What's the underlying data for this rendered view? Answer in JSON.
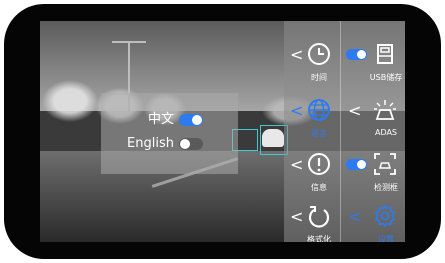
{
  "language_popup": {
    "options": [
      {
        "label": "中文",
        "state": "on"
      },
      {
        "label": "English",
        "state": "off"
      }
    ]
  },
  "menu": {
    "time_label": "时间",
    "usb_label": "USB储存",
    "language_label": "语言",
    "adas_label": "ADAS",
    "info_label": "信息",
    "detect_label": "检测框",
    "format_label": "格式化",
    "settings_label": "设置"
  },
  "colors": {
    "accent": "#2d7bf0",
    "detection_box": "#3fc9d4"
  },
  "icons": [
    "clock-icon",
    "usb-storage-icon",
    "globe-icon",
    "adas-icon",
    "info-icon",
    "detection-frame-icon",
    "format-icon",
    "settings-gear-icon",
    "chevron-left-icon"
  ]
}
